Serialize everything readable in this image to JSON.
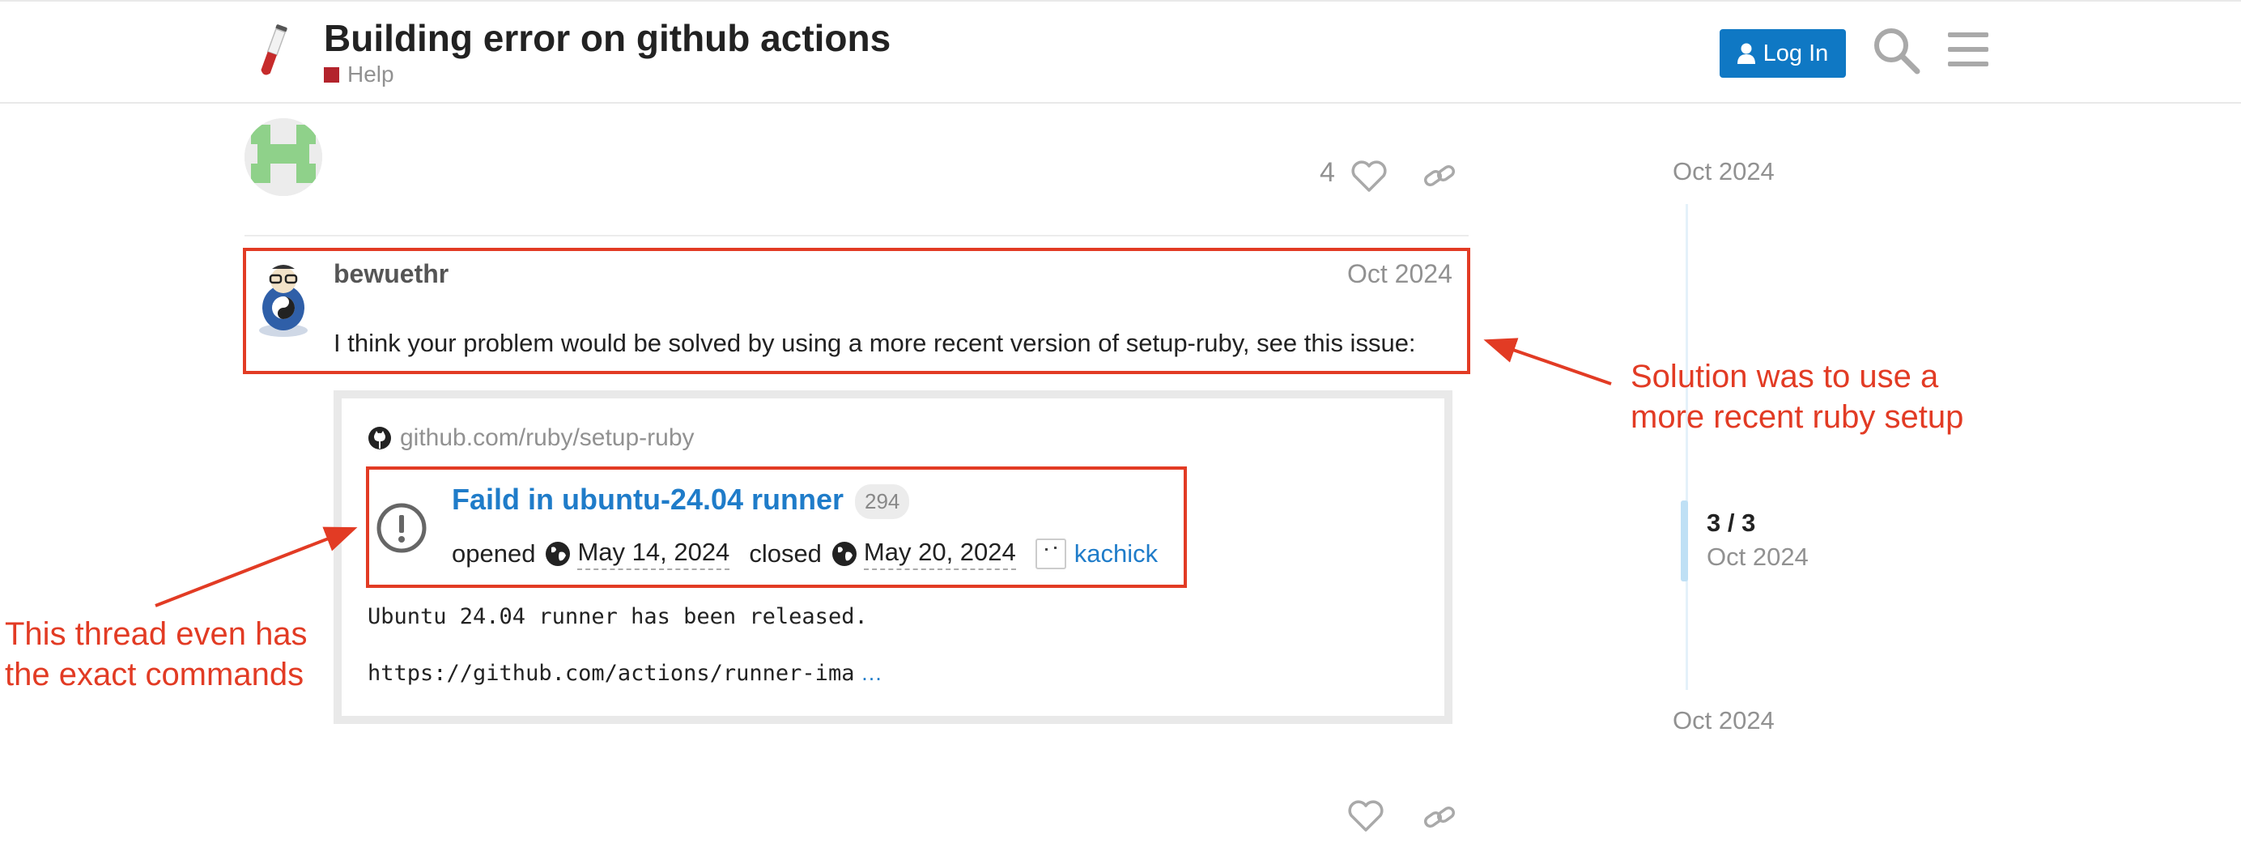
{
  "header": {
    "title": "Building error on github actions",
    "category": "Help",
    "category_color": "#b3232c",
    "login_label": "Log In",
    "icons": [
      "site-logo-icon",
      "user-icon",
      "search-icon",
      "menu-icon"
    ]
  },
  "first_post": {
    "like_count": "4"
  },
  "reply": {
    "username": "bewuethr",
    "date": "Oct 2024",
    "text": "I think your problem would be solved by using a more recent version of setup-ruby, see this issue:"
  },
  "onebox": {
    "source": "github.com/ruby/setup-ruby",
    "issue_title": "Faild in ubuntu-24.04 runner",
    "issue_number": "294",
    "opened_label": "opened",
    "opened_date": "May 14, 2024",
    "closed_label": "closed",
    "closed_date": "May 20, 2024",
    "author": "kachick",
    "body_line_1": "Ubuntu 24.04 runner has been released.",
    "body_line_2": "https://github.com/actions/runner-ima",
    "body_more": " …"
  },
  "timeline": {
    "top_date": "Oct 2024",
    "position": "3 / 3",
    "position_date": "Oct 2024",
    "bottom_date": "Oct 2024"
  },
  "annotations": {
    "color": "#e23b24",
    "solution_line_1": "Solution was to use a",
    "solution_line_2": "more recent ruby setup",
    "thread_line_1": "This thread even has",
    "thread_line_2": "the exact commands"
  },
  "colors": {
    "accent": "#0f78c4",
    "link": "#1f7cc9",
    "muted": "#919191"
  }
}
